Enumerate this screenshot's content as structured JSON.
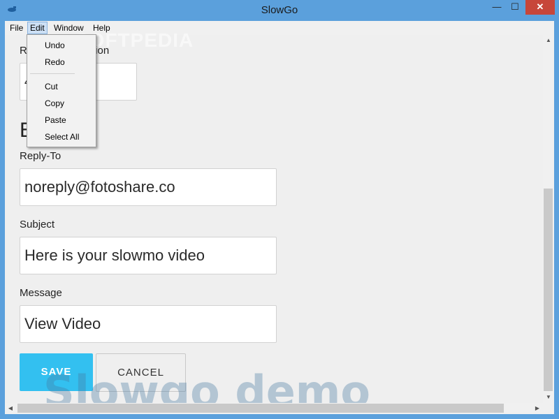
{
  "window": {
    "title": "SlowGo",
    "min": "—",
    "max": "☐",
    "close": "✕"
  },
  "menubar": {
    "items": [
      "File",
      "Edit",
      "Window",
      "Help"
    ]
  },
  "edit_menu": {
    "items": [
      "Undo",
      "Redo",
      "Cut",
      "Copy",
      "Paste",
      "Select All"
    ]
  },
  "form": {
    "partial_label_left": "R",
    "partial_label_right": "tion",
    "partial_value": "4",
    "section_heading": "E",
    "reply_to_label": "Reply-To",
    "reply_to_value": "noreply@fotoshare.co",
    "subject_label": "Subject",
    "subject_value": "Here is your slowmo video",
    "message_label": "Message",
    "message_value": "View Video"
  },
  "buttons": {
    "save": "SAVE",
    "cancel": "CANCEL"
  },
  "watermarks": {
    "demo": "Slowgo demo",
    "softpedia": "SOFTPEDIA"
  },
  "scrollbars": {
    "up": "▲",
    "down": "▼",
    "left": "◀",
    "right": "▶"
  },
  "colors": {
    "accent": "#33c0f0",
    "titlebar": "#5ba0dc",
    "close": "#c7463a"
  }
}
